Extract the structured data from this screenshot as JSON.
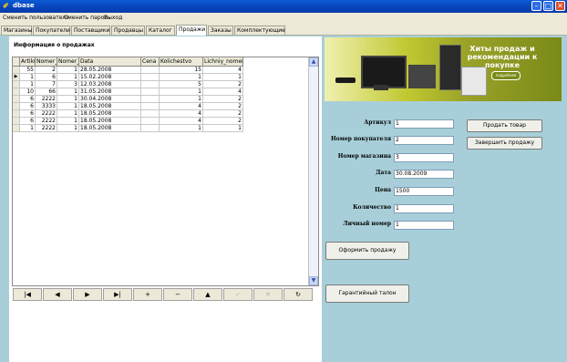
{
  "window": {
    "title": "dbase",
    "controls": {
      "minimize": "minimize-icon",
      "maximize": "maximize-icon",
      "close": "close-icon"
    }
  },
  "menu": [
    "Сменить пользователя",
    "Сменить пароль",
    "Выход"
  ],
  "tabs": [
    "Магазины",
    "Покупатели",
    "Поставщики",
    "Продавцы",
    "Каталог",
    "Продажи",
    "Заказы",
    "Комплектующие"
  ],
  "active_tab": "Продажи",
  "sales_section": {
    "title": "Информация о продажах",
    "columns": [
      "Artikul",
      "Nomer_p",
      "Nomer_m",
      "Data",
      "Cena",
      "Kolichestvo",
      "Lichniy_nomer"
    ],
    "rows": [
      [
        "55",
        "2",
        "1",
        "28.05.2008",
        "",
        "15",
        "4"
      ],
      [
        "1",
        "6",
        "1",
        "15.02.2008",
        "",
        "1",
        "1"
      ],
      [
        "1",
        "7",
        "3",
        "12.03.2008",
        "",
        "5",
        "2"
      ],
      [
        "10",
        "66",
        "1",
        "31.05.2008",
        "",
        "1",
        "4"
      ],
      [
        "6",
        "2222",
        "1",
        "30.04.2008",
        "",
        "1",
        "2"
      ],
      [
        "6",
        "3333",
        "1",
        "18.05.2008",
        "",
        "4",
        "2"
      ],
      [
        "6",
        "2222",
        "1",
        "18.05.2008",
        "",
        "4",
        "2"
      ],
      [
        "6",
        "2222",
        "1",
        "18.05.2008",
        "",
        "4",
        "2"
      ],
      [
        "1",
        "2222",
        "1",
        "18.05.2008",
        "",
        "1",
        "1"
      ]
    ],
    "current_row_indicator": "▶"
  },
  "navigator": {
    "buttons": [
      {
        "name": "first-record-button",
        "glyph": "|◀"
      },
      {
        "name": "prior-record-button",
        "glyph": "◀"
      },
      {
        "name": "next-record-button",
        "glyph": "▶"
      },
      {
        "name": "last-record-button",
        "glyph": "▶|"
      },
      {
        "name": "insert-record-button",
        "glyph": "+"
      },
      {
        "name": "delete-record-button",
        "glyph": "−"
      },
      {
        "name": "edit-record-button",
        "glyph": "▲"
      },
      {
        "name": "post-record-button",
        "glyph": "✓"
      },
      {
        "name": "cancel-edit-button",
        "glyph": "✕"
      },
      {
        "name": "refresh-button",
        "glyph": "↻"
      }
    ]
  },
  "banner": {
    "headline": "Хиты продаж и рекомендации к покупке",
    "button": "подробнее"
  },
  "form": {
    "fields": [
      {
        "label": "Артикул",
        "value": "1"
      },
      {
        "label": "Номер покупателя",
        "value": "2"
      },
      {
        "label": "Номер магазина",
        "value": "3"
      },
      {
        "label": "Дата",
        "value": "30.08.2009"
      },
      {
        "label": "Цена",
        "value": "1500"
      },
      {
        "label": "Количество",
        "value": "1"
      },
      {
        "label": "Личный номер",
        "value": "1"
      }
    ]
  },
  "buttons": {
    "sell": "Продать товар",
    "finish": "Завершить продажу",
    "checkout": "Оформить продажу",
    "warranty": "Гарантийный талон"
  }
}
